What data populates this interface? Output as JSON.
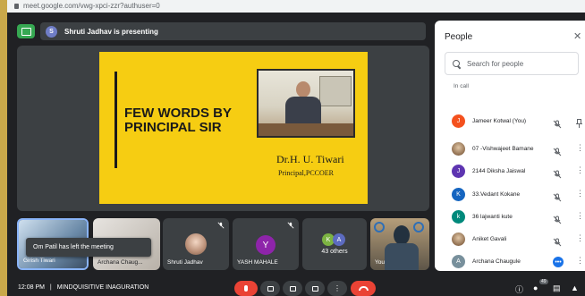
{
  "browser": {
    "url": "meet.google.com/vwg-xpci-zzr?authuser=0"
  },
  "presentation": {
    "presenter_initial": "S",
    "banner_text": "Shruti Jadhav is presenting"
  },
  "slide": {
    "title": "FEW WORDS BY PRINCIPAL SIR",
    "name": "Dr.H. U. Tiwari",
    "role": "Principal,PCCOER"
  },
  "toast": {
    "text": "Om Patil has left the meeting"
  },
  "tiles": [
    {
      "label": "Girish Tiwari"
    },
    {
      "label": "Archana Chaug..."
    },
    {
      "label": "Shruti Jadhav"
    },
    {
      "initial": "Y",
      "label": "YASH MAHALE",
      "color": "#8e24aa"
    },
    {
      "avatars": [
        "K",
        "A"
      ],
      "count_label": "43 others"
    },
    {
      "label": "You"
    }
  ],
  "bottom": {
    "clock": "12:08 PM",
    "separator": "|",
    "meeting_name": "MINDQUISITIVE INAGURATION",
    "participant_badge": "49"
  },
  "people_panel": {
    "title": "People",
    "search_placeholder": "Search for people",
    "section_label": "In call",
    "participants": [
      {
        "initial": "J",
        "name": "Jameer Kotwal (You)",
        "color": "#f4511e",
        "mic": "muted",
        "action": "pin-icon"
      },
      {
        "initial": "",
        "name": "07 -Vishwajeet Bamane",
        "color": "photo",
        "mic": "muted",
        "action": "more-icon"
      },
      {
        "initial": "J",
        "name": "2144 Diksha Jaiswal",
        "color": "#5e35b1",
        "mic": "muted",
        "action": "more-icon"
      },
      {
        "initial": "K",
        "name": "33.Vedant Kokane",
        "color": "#1565c0",
        "mic": "muted",
        "action": "more-icon"
      },
      {
        "initial": "k",
        "name": "36 lajwanti kute",
        "color": "#00897b",
        "mic": "muted",
        "action": "more-icon"
      },
      {
        "initial": "",
        "name": "Aniket Gavali",
        "color": "photo",
        "mic": "muted",
        "action": "more-icon"
      },
      {
        "initial": "A",
        "name": "Archana Chaugule",
        "color": "#78909c",
        "mic": "speaking",
        "action": "more-icon"
      }
    ]
  },
  "colors": {
    "accent_green": "#36a852",
    "end_call_red": "#ea4335",
    "slide_yellow": "#f6cd12"
  }
}
